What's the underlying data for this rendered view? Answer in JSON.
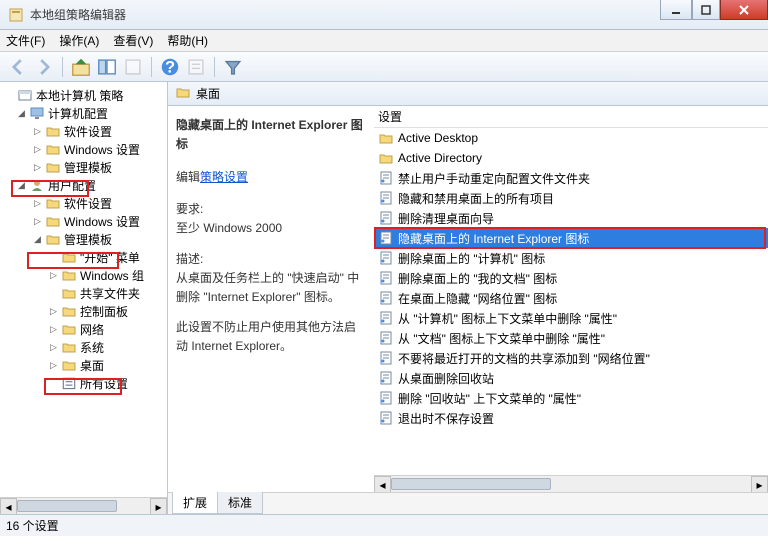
{
  "window": {
    "title": "本地组策略编辑器"
  },
  "menu": {
    "file": "文件(F)",
    "action": "操作(A)",
    "view": "查看(V)",
    "help": "帮助(H)"
  },
  "tree": {
    "root": "本地计算机 策略",
    "computer_config": "计算机配置",
    "cc_software": "软件设置",
    "cc_windows": "Windows 设置",
    "cc_admin": "管理模板",
    "user_config": "用户配置",
    "uc_software": "软件设置",
    "uc_windows": "Windows 设置",
    "uc_admin": "管理模板",
    "uc_start": "\"开始\" 菜单",
    "uc_wincomp": "Windows 组",
    "uc_shared": "共享文件夹",
    "uc_control": "控制面板",
    "uc_network": "网络",
    "uc_system": "系统",
    "uc_desktop": "桌面",
    "uc_all": "所有设置"
  },
  "path": {
    "label": "桌面"
  },
  "detail": {
    "title": "隐藏桌面上的 Internet Explorer 图标",
    "edit_label": "编辑",
    "edit_link": "策略设置",
    "req_label": "要求:",
    "req_value": "至少 Windows 2000",
    "desc_label": "描述:",
    "desc_p1": "从桌面及任务栏上的 \"快速启动\" 中删除 \"Internet Explorer\" 图标。",
    "desc_p2": "此设置不防止用户使用其他方法启动 Internet Explorer。"
  },
  "settings": {
    "header": "设置",
    "items": [
      {
        "type": "folder",
        "label": "Active Desktop"
      },
      {
        "type": "folder",
        "label": "Active Directory"
      },
      {
        "type": "policy",
        "label": "禁止用户手动重定向配置文件文件夹"
      },
      {
        "type": "policy",
        "label": "隐藏和禁用桌面上的所有项目"
      },
      {
        "type": "policy",
        "label": "删除清理桌面向导"
      },
      {
        "type": "policy",
        "label": "隐藏桌面上的 Internet Explorer 图标",
        "selected": true
      },
      {
        "type": "policy",
        "label": "删除桌面上的 \"计算机\" 图标"
      },
      {
        "type": "policy",
        "label": "删除桌面上的 \"我的文档\" 图标"
      },
      {
        "type": "policy",
        "label": "在桌面上隐藏 \"网络位置\" 图标"
      },
      {
        "type": "policy",
        "label": "从 \"计算机\" 图标上下文菜单中删除 \"属性\""
      },
      {
        "type": "policy",
        "label": "从 \"文档\" 图标上下文菜单中删除 \"属性\""
      },
      {
        "type": "policy",
        "label": "不要将最近打开的文档的共享添加到 \"网络位置\""
      },
      {
        "type": "policy",
        "label": "从桌面删除回收站"
      },
      {
        "type": "policy",
        "label": "删除 \"回收站\" 上下文菜单的 \"属性\""
      },
      {
        "type": "policy",
        "label": "退出时不保存设置"
      }
    ]
  },
  "tabs": {
    "extended": "扩展",
    "standard": "标准"
  },
  "status": {
    "text": "16 个设置"
  }
}
